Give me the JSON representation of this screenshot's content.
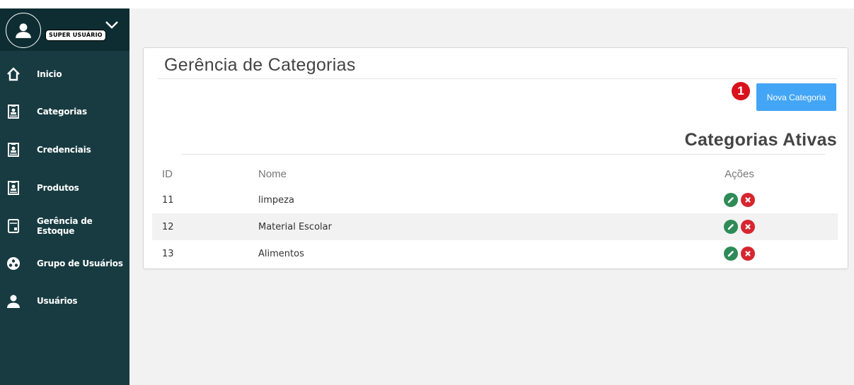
{
  "sidebar": {
    "user_badge": "SUPER USUÁRIO",
    "items": [
      {
        "label": "Inicio",
        "icon": "home-icon"
      },
      {
        "label": "Categorias",
        "icon": "badge-icon"
      },
      {
        "label": "Credenciais",
        "icon": "badge-icon"
      },
      {
        "label": "Produtos",
        "icon": "badge-icon"
      },
      {
        "label": "Gerência de Estoque",
        "icon": "register-icon"
      },
      {
        "label": "Grupo de Usuários",
        "icon": "users-group-icon"
      },
      {
        "label": "Usuários",
        "icon": "user-icon"
      }
    ]
  },
  "main": {
    "title": "Gerência de Categorias",
    "step_badge": "1",
    "new_button": "Nova Categoria",
    "section_title": "Categorias Ativas",
    "table": {
      "headers": {
        "id": "ID",
        "name": "Nome",
        "actions": "Ações"
      },
      "rows": [
        {
          "id": "11",
          "name": "limpeza"
        },
        {
          "id": "12",
          "name": "Material Escolar"
        },
        {
          "id": "13",
          "name": "Alimentos"
        }
      ]
    }
  },
  "colors": {
    "sidebar_bg": "#173b41",
    "user_area_bg": "#0d2d32",
    "accent_button": "#42a5f5",
    "step_badge": "#d8111c",
    "edit_action": "#2e8b57",
    "delete_action": "#d6262f"
  }
}
